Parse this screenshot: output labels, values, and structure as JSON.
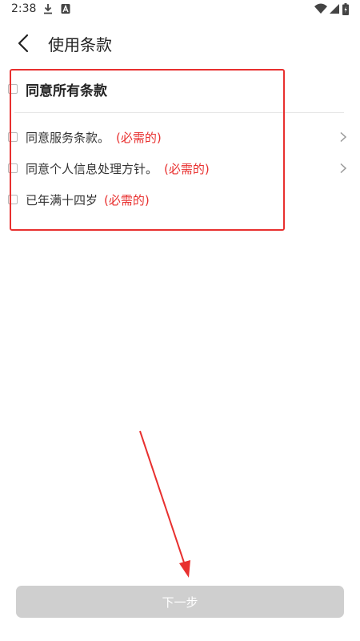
{
  "status_bar": {
    "time": "2:38",
    "icons": [
      "download-icon",
      "a-icon",
      "wifi-icon",
      "signal-icon",
      "battery-icon"
    ]
  },
  "header": {
    "title": "使用条款",
    "back_icon": "back-arrow-icon"
  },
  "terms": {
    "agree_all": {
      "label": "同意所有条款",
      "checked": false
    },
    "items": [
      {
        "label": "同意服务条款。",
        "required": "(必需的)",
        "checked": false,
        "has_detail": true
      },
      {
        "label": "同意个人信息处理方针。",
        "required": "(必需的)",
        "checked": false,
        "has_detail": true
      },
      {
        "label": "已年满十四岁",
        "required": "(必需的)",
        "checked": false,
        "has_detail": false
      }
    ]
  },
  "footer": {
    "next_label": "下一步",
    "enabled": false
  },
  "colors": {
    "highlight": "#e8302f",
    "required_text": "#e8302f",
    "button_disabled": "#cfcfcf"
  }
}
